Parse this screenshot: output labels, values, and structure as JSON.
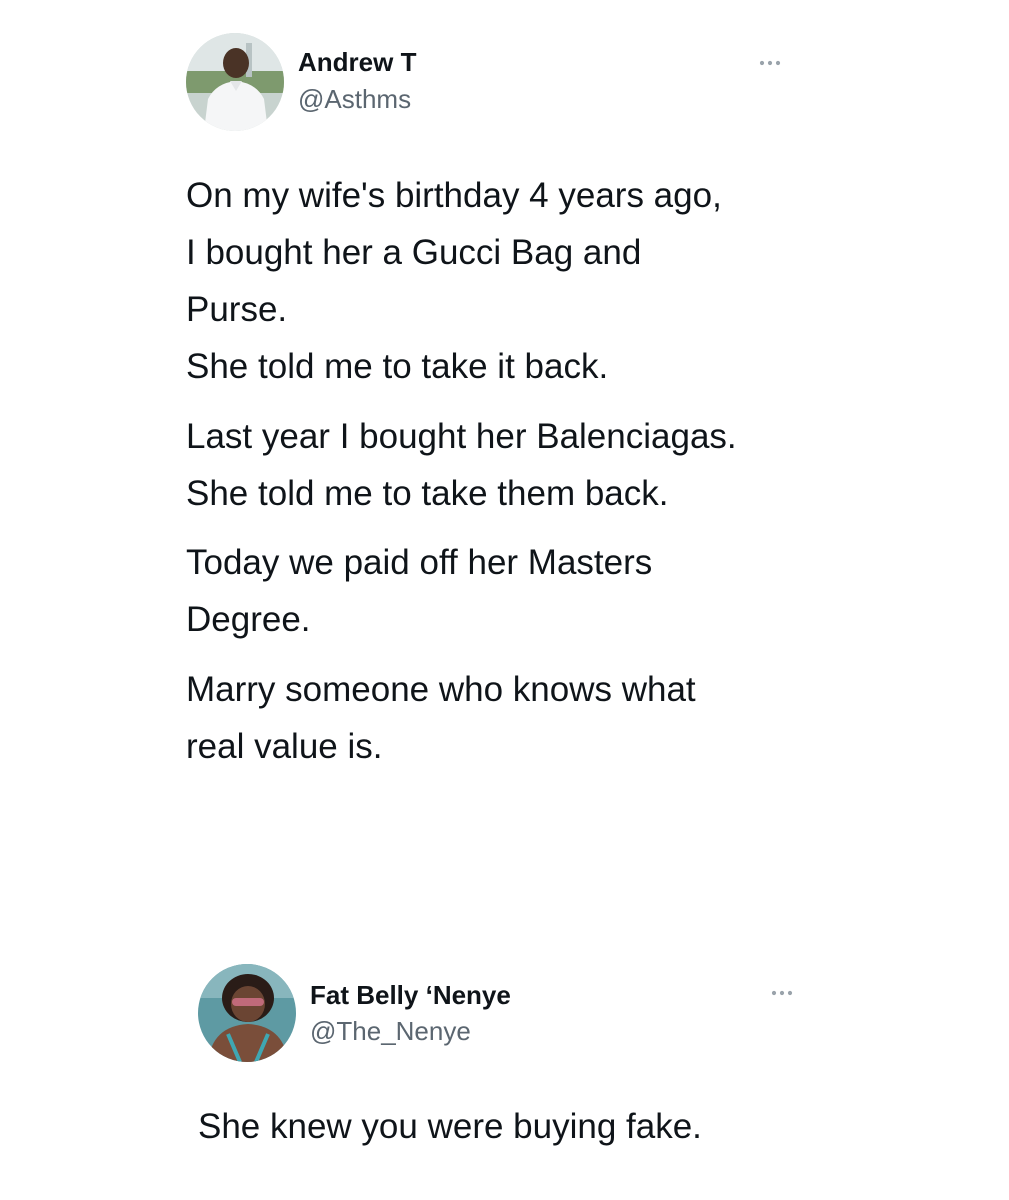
{
  "tweets": [
    {
      "author_name": "Andrew T",
      "author_handle": "@Asthms",
      "more_icon": "ellipsis-icon",
      "lines": [
        "On my wife's birthday 4 years ago,",
        "I bought her a Gucci Bag and",
        "Purse.",
        "She told me to take it back.",
        "Last year I bought her Balenciagas.",
        "She told me to take them back.",
        "Today we paid off her Masters",
        "Degree.",
        "Marry someone who knows what",
        "real value is."
      ]
    },
    {
      "author_name": "Fat Belly ‘Nenye",
      "author_handle": "@The_Nenye",
      "more_icon": "ellipsis-icon",
      "lines": [
        "She knew you were buying fake."
      ]
    }
  ],
  "colors": {
    "text": "#0f1419",
    "secondary": "#5b6670",
    "icon": "#9aa3ab",
    "background": "#ffffff"
  }
}
